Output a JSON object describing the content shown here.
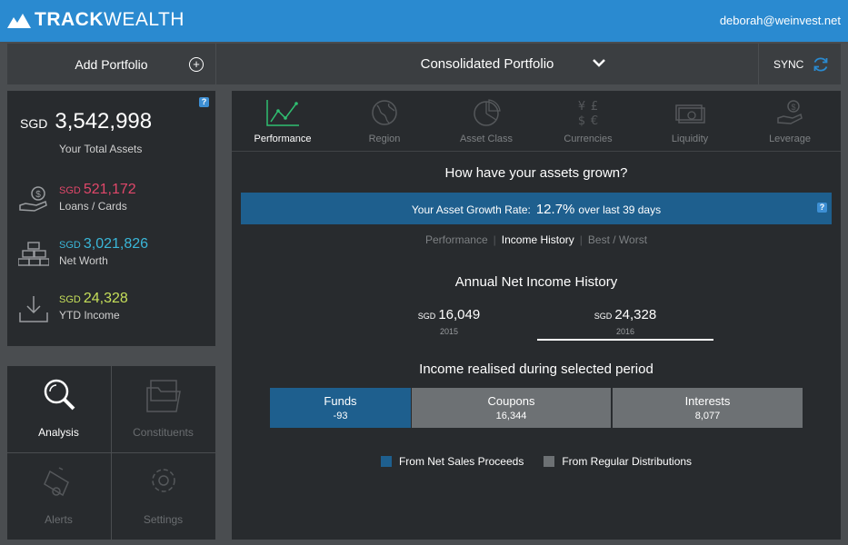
{
  "header": {
    "brand_bold": "TRACK",
    "brand_light": "WEALTH",
    "user_email": "deborah@weinvest.net"
  },
  "subbar": {
    "add_portfolio": "Add Portfolio",
    "portfolio_name": "Consolidated Portfolio",
    "sync_label": "SYNC"
  },
  "assets": {
    "help": "?",
    "total_currency": "SGD",
    "total_value": "3,542,998",
    "total_label": "Your Total Assets",
    "items": [
      {
        "currency": "SGD",
        "value": "521,172",
        "label": "Loans / Cards",
        "color": "#e0476a",
        "icon": "money-hand-icon"
      },
      {
        "currency": "SGD",
        "value": "3,021,826",
        "label": "Net Worth",
        "color": "#3ab6d8",
        "icon": "gold-bars-icon"
      },
      {
        "currency": "SGD",
        "value": "24,328",
        "label": "YTD Income",
        "color": "#c6df5a",
        "icon": "download-tray-icon"
      }
    ]
  },
  "tools": [
    {
      "label": "Analysis",
      "icon": "magnifier-icon",
      "active": true
    },
    {
      "label": "Constituents",
      "icon": "folder-icon",
      "active": false
    },
    {
      "label": "Alerts",
      "icon": "bell-icon",
      "active": false
    },
    {
      "label": "Settings",
      "icon": "gear-icon",
      "active": false
    }
  ],
  "tabs": [
    {
      "label": "Performance",
      "icon": "line-chart-icon",
      "active": true
    },
    {
      "label": "Region",
      "icon": "globe-icon",
      "active": false
    },
    {
      "label": "Asset Class",
      "icon": "pie-chart-icon",
      "active": false
    },
    {
      "label": "Currencies",
      "icon": "currency-symbols-icon",
      "active": false
    },
    {
      "label": "Liquidity",
      "icon": "cash-icon",
      "active": false
    },
    {
      "label": "Leverage",
      "icon": "hand-coin-icon",
      "active": false
    }
  ],
  "main": {
    "question": "How have your assets grown?",
    "growth_label": "Your Asset Growth Rate:",
    "growth_rate": "12.7%",
    "growth_period": "over last 39 days",
    "help": "?",
    "subtabs": [
      "Performance",
      "Income History",
      "Best / Worst"
    ],
    "subtabs_separator": "|",
    "annual_title": "Annual Net Income History",
    "years": [
      {
        "currency": "SGD",
        "value": "16,049",
        "year": "2015"
      },
      {
        "currency": "SGD",
        "value": "24,328",
        "year": "2016"
      }
    ],
    "realised_title": "Income realised during selected period",
    "income_segments": [
      {
        "name": "Funds",
        "value": "-93",
        "color": "#1e5f8e"
      },
      {
        "name": "Coupons",
        "value": "16,344",
        "color": "#6d7174"
      },
      {
        "name": "Interests",
        "value": "8,077",
        "color": "#6d7174"
      }
    ],
    "legend": [
      {
        "label": "From Net Sales Proceeds",
        "color": "#1e5f8e"
      },
      {
        "label": "From Regular Distributions",
        "color": "#6d7174"
      }
    ]
  },
  "colors": {
    "topbar": "#2a8ad0",
    "panel": "#282b2e",
    "accent_green": "#2fbf71"
  }
}
